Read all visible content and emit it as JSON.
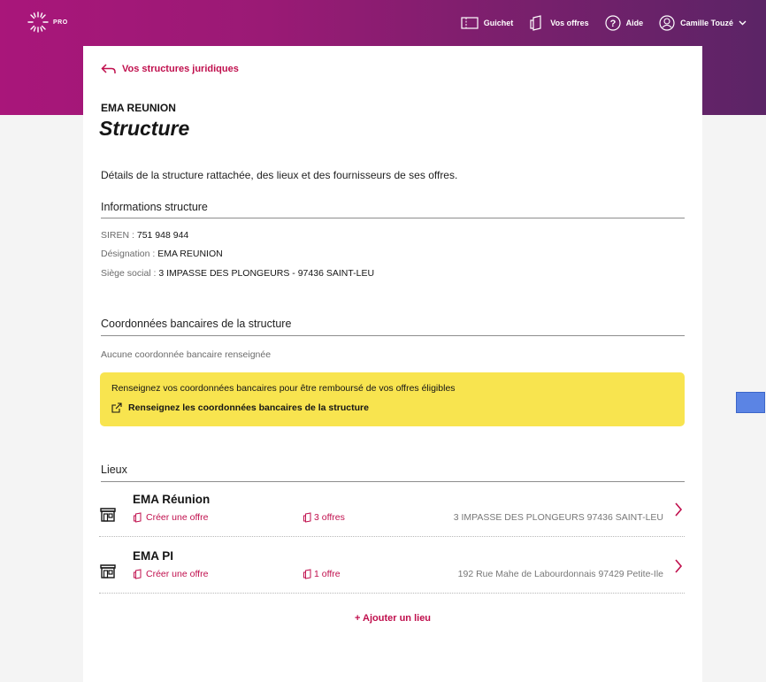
{
  "header": {
    "logo_text": "PRO",
    "nav": [
      {
        "label": "Guichet",
        "icon": "ticket-icon"
      },
      {
        "label": "Vos offres",
        "icon": "offers-icon"
      },
      {
        "label": "Aide",
        "icon": "help-icon"
      },
      {
        "label": "Camille Touzé",
        "icon": "user-icon"
      }
    ]
  },
  "page": {
    "back_label": "Vos structures juridiques",
    "eyebrow": "EMA REUNION",
    "title": "Structure",
    "description": "Détails de la structure rattachée, des lieux et des fournisseurs de ses offres."
  },
  "info": {
    "section_title": "Informations structure",
    "siren_label": "SIREN :",
    "siren_value": "751 948 944",
    "designation_label": "Désignation :",
    "designation_value": "EMA REUNION",
    "siege_label": "Siège social :",
    "siege_value": "3 IMPASSE DES PLONGEURS - 97436 SAINT-LEU"
  },
  "bank": {
    "section_title": "Coordonnées bancaires de la structure",
    "empty_text": "Aucune coordonnée bancaire renseignée",
    "banner_text": "Renseignez vos coordonnées bancaires pour être remboursé de vos offres éligibles",
    "banner_link": "Renseignez les coordonnées bancaires de la structure"
  },
  "venues": {
    "section_title": "Lieux",
    "items": [
      {
        "name": "EMA Réunion",
        "create_label": "Créer une offre",
        "offers_label": "3 offres",
        "address": "3 IMPASSE DES PLONGEURS 97436 SAINT-LEU"
      },
      {
        "name": "EMA PI",
        "create_label": "Créer une offre",
        "offers_label": "1 offre",
        "address": "192 Rue Mahe de Labourdonnais 97429 Petite-Ile"
      }
    ],
    "add_label": "+ Ajouter un lieu"
  },
  "colors": {
    "brand": "#c00f4d",
    "banner": "#f8e44f",
    "header_gradient_start": "#a9167a",
    "header_gradient_end": "#5b2466"
  }
}
